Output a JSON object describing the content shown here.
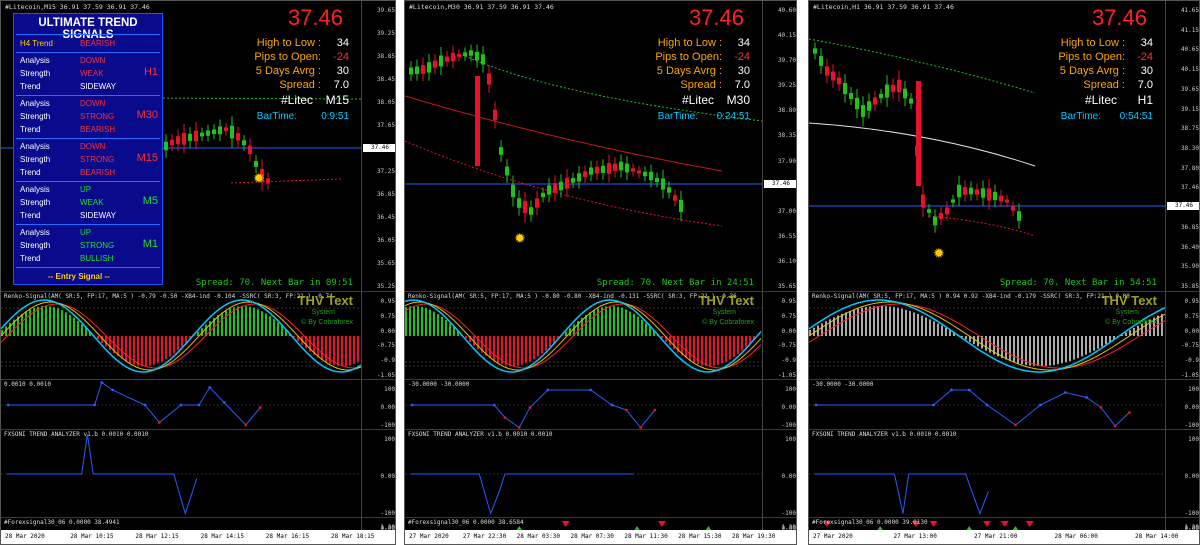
{
  "panels": [
    {
      "id": "m15",
      "header": "#Litecoin,M15  36.91 37.59 36.91 37.46",
      "price": "37.46",
      "info": {
        "high_to_low_label": "High to Low :",
        "high_to_low": "34",
        "pips_label": "Pips to Open:",
        "pips": "-24",
        "avg_label": "5 Days Avrg :",
        "avg": "30",
        "spread_label": "Spread     :",
        "spread": "7.0",
        "symbol": "#Litec",
        "tf": "M15",
        "bartime_label": "BarTime:",
        "bartime": "0:9:51"
      },
      "spread_line": "Spread: 70. Next Bar in 09:51",
      "price_axis": [
        "39.65",
        "39.25",
        "38.85",
        "38.45",
        "38.05",
        "37.65",
        "37.46",
        "37.25",
        "36.85",
        "36.45",
        "36.05",
        "35.65",
        "35.25"
      ],
      "current_tag": "37.46",
      "renko_header": "Renko-Signal(AM( SR:5, FP:17, MA:5 ) -0.79 -0.50 -XB4-ind -0.104 -SSRC( SR:3, FP:21 ) -0.74",
      "renko_axis": [
        "0.95",
        "0.75",
        "0.00",
        "-0.75",
        "-0.9",
        "-1.05"
      ],
      "ind2_header": "0.0010 0.0010",
      "ind2_axis": [
        "100",
        "0.00",
        "-100"
      ],
      "fxsoni_header": "FXSONI TREND ANALYZER v1.b 0.0010 0.0010",
      "fxsoni_axis": [
        "100",
        "0.00",
        "-100"
      ],
      "fx30_header": "#Forexsignal30_06 0.0000 38.4941",
      "fx30_axis": [
        "1.30",
        "0.00"
      ],
      "time_labels": [
        "28 Mar 2020",
        "28 Mar 10:15",
        "28 Mar 12:15",
        "28 Mar 14:15",
        "28 Mar 16:15",
        "28 Mar 18:15"
      ]
    },
    {
      "id": "m30",
      "header": "#Litecoin,M30  36.91 37.59 36.91 37.46",
      "price": "37.46",
      "info": {
        "high_to_low_label": "High to Low :",
        "high_to_low": "34",
        "pips_label": "Pips to Open:",
        "pips": "-24",
        "avg_label": "5 Days Avrg :",
        "avg": "30",
        "spread_label": "Spread     :",
        "spread": "7.0",
        "symbol": "#Litec",
        "tf": "M30",
        "bartime_label": "BarTime:",
        "bartime": "0:24:51"
      },
      "spread_line": "Spread: 70. Next Bar in 24:51",
      "price_axis": [
        "40.60",
        "40.15",
        "39.70",
        "39.25",
        "38.80",
        "38.35",
        "37.90",
        "37.46",
        "37.00",
        "36.55",
        "36.10",
        "35.65"
      ],
      "current_tag": "37.46",
      "renko_header": "Renko-Signal(AM( SR:5, FP:17, MA:5 ) -0.80 -0.80 -XB4-ind -0.131 -SSRC( SR:3, FP:21 ) -0.36",
      "renko_axis": [
        "0.95",
        "0.75",
        "0.00",
        "-0.75",
        "-0.9",
        "-1.05"
      ],
      "ind2_header": "-30.0000 -30.0000",
      "ind2_axis": [
        "100",
        "0.00",
        "-100"
      ],
      "fxsoni_header": "FXSONI TREND ANALYZER v1.b 0.0010 0.0010",
      "fxsoni_axis": [
        "100",
        "0.00",
        "-100"
      ],
      "fx30_header": "#Forexsignal30_06 0.0000 38.6584",
      "fx30_axis": [
        "1.30",
        "0.00"
      ],
      "time_labels": [
        "27 Mar 2020",
        "27 Mar 22:30",
        "28 Mar 03:30",
        "28 Mar 07:30",
        "28 Mar 11:30",
        "28 Mar 15:30",
        "28 Mar 19:30"
      ]
    },
    {
      "id": "h1",
      "header": "#Litecoin,H1  36.91 37.59 36.91 37.46",
      "price": "37.46",
      "info": {
        "high_to_low_label": "High to Low :",
        "high_to_low": "34",
        "pips_label": "Pips to Open:",
        "pips": "-24",
        "avg_label": "5 Days Avrg :",
        "avg": "30",
        "spread_label": "Spread     :",
        "spread": "7.0",
        "symbol": "#Litec",
        "tf": "H1",
        "bartime_label": "BarTime:",
        "bartime": "0:54:51"
      },
      "spread_line": "Spread: 70. Next Bar in 54:51",
      "price_axis": [
        "41.65",
        "41.15",
        "40.65",
        "40.15",
        "39.65",
        "39.15",
        "38.75",
        "38.30",
        "37.80",
        "37.46",
        "37.35",
        "36.85",
        "36.40",
        "35.90",
        "35.85"
      ],
      "current_tag": "37.46",
      "renko_header": "Renko-Signal(AM( SR:5, FP:17, MA:5 ) 0.94 0.92 -XB4-ind -0.179 -SSRC( SR:3, FP:21 ) 0.00",
      "renko_axis": [
        "0.95",
        "0.75",
        "0.00",
        "-0.75",
        "-0.9",
        "-1.05"
      ],
      "ind2_header": "-30.0000 -30.0000",
      "ind2_axis": [
        "100",
        "0.00",
        "-100"
      ],
      "fxsoni_header": "FXSONI TREND ANALYZER v1.b 0.0010 0.0010",
      "fxsoni_axis": [
        "100",
        "0.00",
        "-100"
      ],
      "fx30_header": "#Forexsignal30_06 0.0000 39.0130",
      "fx30_axis": [
        "1.30",
        "0.00"
      ],
      "time_labels": [
        "27 Mar 2020",
        "27 Mar 13:00",
        "27 Mar 21:00",
        "28 Mar 06:00",
        "28 Mar 14:00"
      ]
    }
  ],
  "thv": {
    "title": "THV Text",
    "system": "System",
    "by": "© By Cobraforex"
  },
  "signals_box": {
    "title": "ULTIMATE TREND SIGNALS",
    "h4_label": "H4 Trend",
    "h4_value": "BEARISH",
    "blocks": [
      {
        "tf": "H1",
        "analysis": "DOWN",
        "strength": "WEAK",
        "trend": "SIDEWAY"
      },
      {
        "tf": "M30",
        "analysis": "DOWN",
        "strength": "STRONG",
        "trend": "BEARISH"
      },
      {
        "tf": "M15",
        "analysis": "DOWN",
        "strength": "STRONG",
        "trend": "BEARISH"
      },
      {
        "tf": "M5",
        "analysis": "UP",
        "strength": "WEAK",
        "trend": "SIDEWAY"
      },
      {
        "tf": "M1",
        "analysis": "UP",
        "strength": "STRONG",
        "trend": "BULLISH"
      }
    ],
    "labels": {
      "analysis": "Analysis",
      "strength": "Strength",
      "trend": "Trend"
    },
    "entry": "-- Entry Signal --"
  },
  "colors": {
    "bull": "#1ec31e",
    "bear": "#e8102a",
    "blue": "#2a5cff",
    "cyan": "#00c8ff",
    "gold": "#ffcc00"
  }
}
